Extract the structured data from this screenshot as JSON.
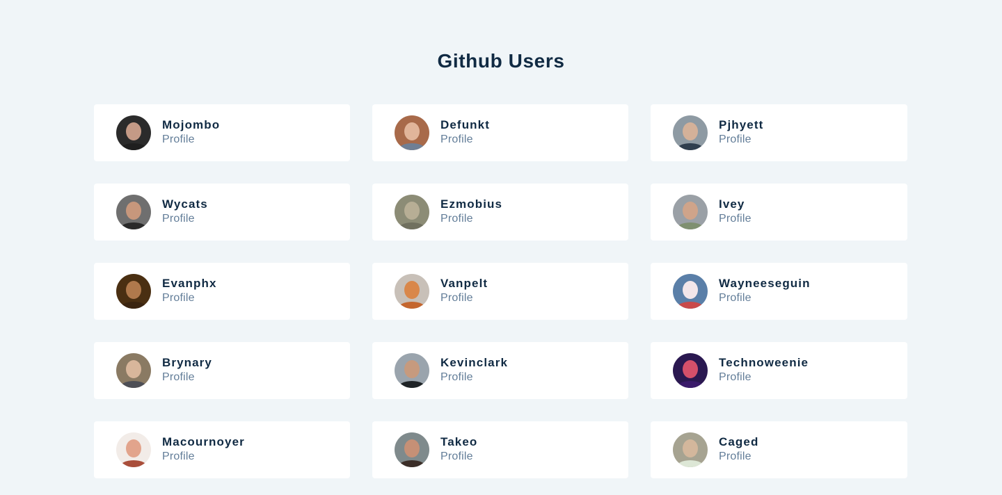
{
  "header": {
    "title": "Github Users"
  },
  "users": [
    {
      "name": "Mojombo",
      "link": "Profile",
      "colors": {
        "bg": "#2b2b2b",
        "face": "#c49a86",
        "body": "#1f1f1f"
      }
    },
    {
      "name": "Defunkt",
      "link": "Profile",
      "colors": {
        "bg": "#a86a4a",
        "face": "#e1b59a",
        "body": "#6f7f95"
      }
    },
    {
      "name": "Pjhyett",
      "link": "Profile",
      "colors": {
        "bg": "#8e9aa3",
        "face": "#d4b199",
        "body": "#2f3e4e"
      }
    },
    {
      "name": "Wycats",
      "link": "Profile",
      "colors": {
        "bg": "#6f6f6f",
        "face": "#c7977c",
        "body": "#2a2a2a"
      }
    },
    {
      "name": "Ezmobius",
      "link": "Profile",
      "colors": {
        "bg": "#8c8c76",
        "face": "#b7ae95",
        "body": "#70705f"
      }
    },
    {
      "name": "Ivey",
      "link": "Profile",
      "colors": {
        "bg": "#9aa0a6",
        "face": "#cfa48a",
        "body": "#7f9070"
      }
    },
    {
      "name": "Evanphx",
      "link": "Profile",
      "colors": {
        "bg": "#4a2f12",
        "face": "#b0794c",
        "body": "#3a2410"
      }
    },
    {
      "name": "Vanpelt",
      "link": "Profile",
      "colors": {
        "bg": "#c8c0b8",
        "face": "#d9874a",
        "body": "#c4662e"
      }
    },
    {
      "name": "Wayneeseguin",
      "link": "Profile",
      "colors": {
        "bg": "#5a7fa8",
        "face": "#f2e6ea",
        "body": "#c94a4a"
      }
    },
    {
      "name": "Brynary",
      "link": "Profile",
      "colors": {
        "bg": "#8a7a63",
        "face": "#d8b69b",
        "body": "#4d4e55"
      }
    },
    {
      "name": "Kevinclark",
      "link": "Profile",
      "colors": {
        "bg": "#9aa4ad",
        "face": "#c69a7e",
        "body": "#1e2326"
      }
    },
    {
      "name": "Technoweenie",
      "link": "Profile",
      "colors": {
        "bg": "#2a1850",
        "face": "#d4506a",
        "body": "#3a1a6a"
      }
    },
    {
      "name": "Macournoyer",
      "link": "Profile",
      "colors": {
        "bg": "#f2ece8",
        "face": "#e2a48c",
        "body": "#a94e3a"
      }
    },
    {
      "name": "Takeo",
      "link": "Profile",
      "colors": {
        "bg": "#7f8a8c",
        "face": "#c69076",
        "body": "#3b2e28"
      }
    },
    {
      "name": "Caged",
      "link": "Profile",
      "colors": {
        "bg": "#a6a391",
        "face": "#d3b79c",
        "body": "#dde7d6"
      }
    }
  ]
}
